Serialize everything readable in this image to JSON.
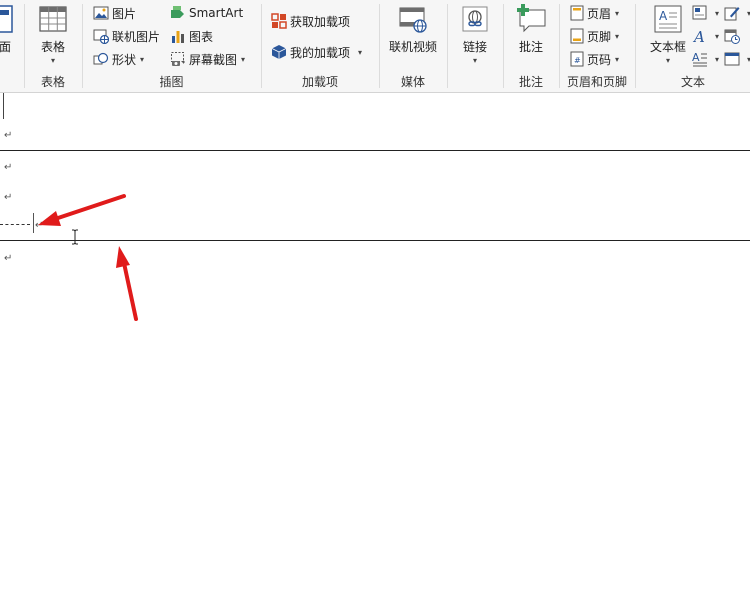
{
  "ribbon": {
    "groups": {
      "pages": {
        "button_label": "面"
      },
      "tables": {
        "button_label": "表格",
        "group_label": "表格"
      },
      "illustrations": {
        "group_label": "插图",
        "items": {
          "picture": "图片",
          "online_picture": "联机图片",
          "shapes": "形状",
          "smartart": "SmartArt",
          "chart": "图表",
          "screenshot": "屏幕截图"
        }
      },
      "addins": {
        "group_label": "加载项",
        "get_addins": "获取加载项",
        "my_addins": "我的加载项"
      },
      "media": {
        "group_label": "媒体",
        "online_video": "联机视频"
      },
      "links": {
        "button_label": "链接"
      },
      "comments": {
        "group_label": "批注",
        "comment": "批注"
      },
      "header_footer": {
        "group_label": "页眉和页脚",
        "header": "页眉",
        "footer": "页脚",
        "page_number": "页码"
      },
      "text": {
        "group_label": "文本",
        "text_box": "文本框"
      }
    }
  },
  "document": {
    "paragraph_mark": "↵"
  },
  "colors": {
    "arrow": "#e01b1b",
    "office_blue": "#2b579a",
    "addin_orange": "#d24726"
  }
}
